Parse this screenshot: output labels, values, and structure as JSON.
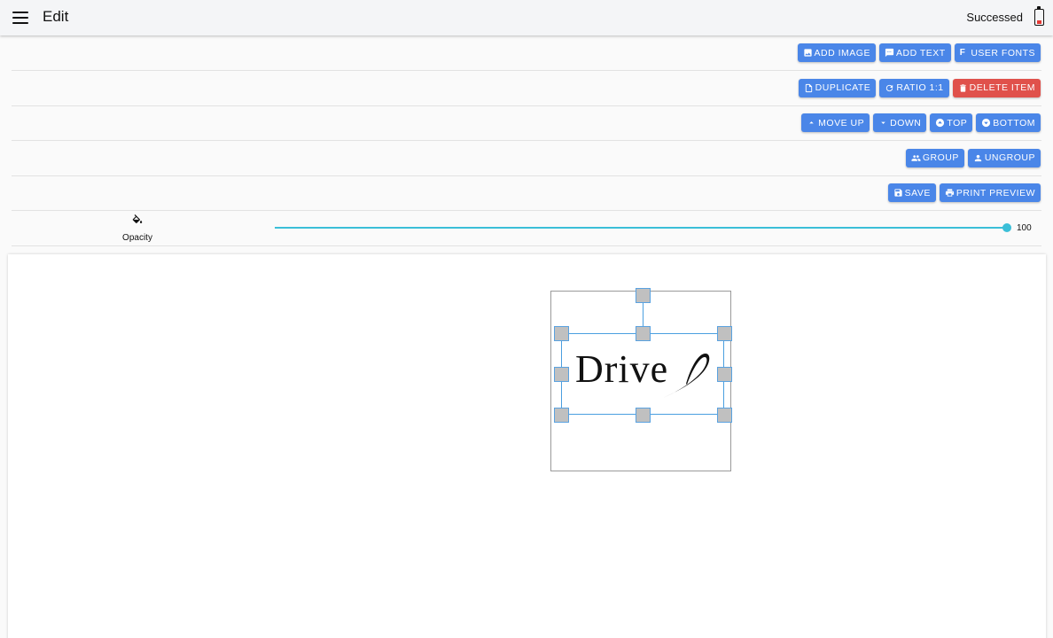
{
  "appbar": {
    "title": "Edit",
    "status": "Successed",
    "menu_icon": "hamburger-menu-icon",
    "battery_icon": "battery-low-icon",
    "battery_color": "#e53935"
  },
  "toolbar": {
    "rows": [
      [
        {
          "name": "add-image",
          "label": "ADD IMAGE",
          "icon": "image-icon"
        },
        {
          "name": "add-text",
          "label": "ADD TEXT",
          "icon": "text-message-icon"
        },
        {
          "name": "user-fonts",
          "label": "USER FONTS",
          "icon": "f-letter-icon",
          "glyph": "F"
        }
      ],
      [
        {
          "name": "duplicate",
          "label": "DUPLICATE",
          "icon": "file-copy-icon"
        },
        {
          "name": "ratio",
          "label": "RATIO 1:1",
          "icon": "refresh-icon"
        },
        {
          "name": "delete-item",
          "label": "DELETE ITEM",
          "icon": "trash-icon",
          "variant": "danger"
        }
      ],
      [
        {
          "name": "move-up",
          "label": "MOVE UP",
          "icon": "caret-up-icon"
        },
        {
          "name": "down",
          "label": "DOWN",
          "icon": "caret-down-icon"
        },
        {
          "name": "top",
          "label": "TOP",
          "icon": "circle-up-icon"
        },
        {
          "name": "bottom",
          "label": "BOTTOM",
          "icon": "circle-down-icon"
        }
      ],
      [
        {
          "name": "group",
          "label": "GROUP",
          "icon": "people-icon"
        },
        {
          "name": "ungroup",
          "label": "UNGROUP",
          "icon": "person-icon"
        }
      ],
      [
        {
          "name": "save",
          "label": "SAVE",
          "icon": "floppy-disk-icon"
        },
        {
          "name": "print-preview",
          "label": "PRINT PREVIEW",
          "icon": "printer-icon"
        }
      ]
    ],
    "colors": {
      "primary": "#4a86e8",
      "danger": "#e0514b"
    }
  },
  "opacity": {
    "label": "Opacity",
    "icon": "paint-bucket-icon",
    "value": 100,
    "value_text": "100",
    "max": 100,
    "accent": "#3bbfd8"
  },
  "canvas": {
    "logo_text": "Drive",
    "selection_color": "#4a9fe0"
  }
}
